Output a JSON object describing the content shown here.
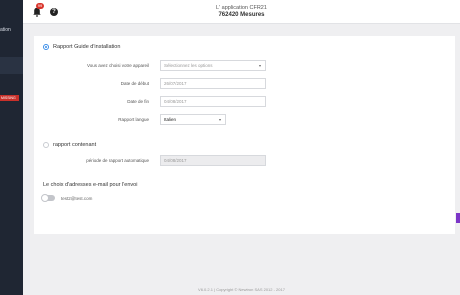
{
  "sidebar": {
    "nav_item": "ation",
    "badge": "MISSING"
  },
  "header": {
    "notification_count": "99",
    "help_glyph": "?",
    "app_title": "L' application CFR21",
    "subtitle": "762420 Mesures"
  },
  "report_guide": {
    "label": "Rapport Guide d'installation",
    "selected": true,
    "fields": {
      "devices": {
        "label": "Vous avez choisi votre appareil",
        "placeholder": "Sélectionnez les options"
      },
      "start_date": {
        "label": "Date de début",
        "value": "26/07/2017"
      },
      "end_date": {
        "label": "Date de fin",
        "value": "04/08/2017"
      },
      "language": {
        "label": "Rapport langue",
        "value": "Italien"
      }
    }
  },
  "report_containing": {
    "label": "rapport contenant",
    "selected": false,
    "period_label": "période de rapport automatique",
    "period_value": "04/08/2017"
  },
  "email_section": {
    "title": "Le choix d'adresses e-mail pour l'envoi",
    "email": "test2@test.com",
    "toggle_on": false
  },
  "footer": {
    "text": "V6.0.2.1 | Copyright © Newtron SAS 2012 - 2017"
  },
  "colors": {
    "sidebar": "#1f2633",
    "accent_blue": "#3a8de8",
    "notif_red": "#d9342b",
    "side_button": "#7b35c7"
  },
  "icons": {
    "bell": "bell-icon",
    "help": "help-icon",
    "caret": "caret-down-icon"
  }
}
